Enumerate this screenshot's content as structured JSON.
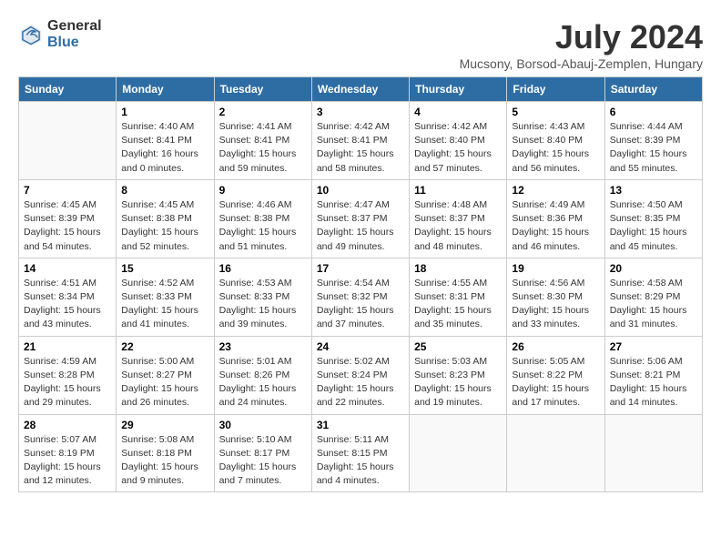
{
  "logo": {
    "text_general": "General",
    "text_blue": "Blue"
  },
  "title": "July 2024",
  "subtitle": "Mucsony, Borsod-Abauj-Zemplen, Hungary",
  "days_of_week": [
    "Sunday",
    "Monday",
    "Tuesday",
    "Wednesday",
    "Thursday",
    "Friday",
    "Saturday"
  ],
  "weeks": [
    [
      {
        "day": "",
        "info": ""
      },
      {
        "day": "1",
        "info": "Sunrise: 4:40 AM\nSunset: 8:41 PM\nDaylight: 16 hours\nand 0 minutes."
      },
      {
        "day": "2",
        "info": "Sunrise: 4:41 AM\nSunset: 8:41 PM\nDaylight: 15 hours\nand 59 minutes."
      },
      {
        "day": "3",
        "info": "Sunrise: 4:42 AM\nSunset: 8:41 PM\nDaylight: 15 hours\nand 58 minutes."
      },
      {
        "day": "4",
        "info": "Sunrise: 4:42 AM\nSunset: 8:40 PM\nDaylight: 15 hours\nand 57 minutes."
      },
      {
        "day": "5",
        "info": "Sunrise: 4:43 AM\nSunset: 8:40 PM\nDaylight: 15 hours\nand 56 minutes."
      },
      {
        "day": "6",
        "info": "Sunrise: 4:44 AM\nSunset: 8:39 PM\nDaylight: 15 hours\nand 55 minutes."
      }
    ],
    [
      {
        "day": "7",
        "info": "Sunrise: 4:45 AM\nSunset: 8:39 PM\nDaylight: 15 hours\nand 54 minutes."
      },
      {
        "day": "8",
        "info": "Sunrise: 4:45 AM\nSunset: 8:38 PM\nDaylight: 15 hours\nand 52 minutes."
      },
      {
        "day": "9",
        "info": "Sunrise: 4:46 AM\nSunset: 8:38 PM\nDaylight: 15 hours\nand 51 minutes."
      },
      {
        "day": "10",
        "info": "Sunrise: 4:47 AM\nSunset: 8:37 PM\nDaylight: 15 hours\nand 49 minutes."
      },
      {
        "day": "11",
        "info": "Sunrise: 4:48 AM\nSunset: 8:37 PM\nDaylight: 15 hours\nand 48 minutes."
      },
      {
        "day": "12",
        "info": "Sunrise: 4:49 AM\nSunset: 8:36 PM\nDaylight: 15 hours\nand 46 minutes."
      },
      {
        "day": "13",
        "info": "Sunrise: 4:50 AM\nSunset: 8:35 PM\nDaylight: 15 hours\nand 45 minutes."
      }
    ],
    [
      {
        "day": "14",
        "info": "Sunrise: 4:51 AM\nSunset: 8:34 PM\nDaylight: 15 hours\nand 43 minutes."
      },
      {
        "day": "15",
        "info": "Sunrise: 4:52 AM\nSunset: 8:33 PM\nDaylight: 15 hours\nand 41 minutes."
      },
      {
        "day": "16",
        "info": "Sunrise: 4:53 AM\nSunset: 8:33 PM\nDaylight: 15 hours\nand 39 minutes."
      },
      {
        "day": "17",
        "info": "Sunrise: 4:54 AM\nSunset: 8:32 PM\nDaylight: 15 hours\nand 37 minutes."
      },
      {
        "day": "18",
        "info": "Sunrise: 4:55 AM\nSunset: 8:31 PM\nDaylight: 15 hours\nand 35 minutes."
      },
      {
        "day": "19",
        "info": "Sunrise: 4:56 AM\nSunset: 8:30 PM\nDaylight: 15 hours\nand 33 minutes."
      },
      {
        "day": "20",
        "info": "Sunrise: 4:58 AM\nSunset: 8:29 PM\nDaylight: 15 hours\nand 31 minutes."
      }
    ],
    [
      {
        "day": "21",
        "info": "Sunrise: 4:59 AM\nSunset: 8:28 PM\nDaylight: 15 hours\nand 29 minutes."
      },
      {
        "day": "22",
        "info": "Sunrise: 5:00 AM\nSunset: 8:27 PM\nDaylight: 15 hours\nand 26 minutes."
      },
      {
        "day": "23",
        "info": "Sunrise: 5:01 AM\nSunset: 8:26 PM\nDaylight: 15 hours\nand 24 minutes."
      },
      {
        "day": "24",
        "info": "Sunrise: 5:02 AM\nSunset: 8:24 PM\nDaylight: 15 hours\nand 22 minutes."
      },
      {
        "day": "25",
        "info": "Sunrise: 5:03 AM\nSunset: 8:23 PM\nDaylight: 15 hours\nand 19 minutes."
      },
      {
        "day": "26",
        "info": "Sunrise: 5:05 AM\nSunset: 8:22 PM\nDaylight: 15 hours\nand 17 minutes."
      },
      {
        "day": "27",
        "info": "Sunrise: 5:06 AM\nSunset: 8:21 PM\nDaylight: 15 hours\nand 14 minutes."
      }
    ],
    [
      {
        "day": "28",
        "info": "Sunrise: 5:07 AM\nSunset: 8:19 PM\nDaylight: 15 hours\nand 12 minutes."
      },
      {
        "day": "29",
        "info": "Sunrise: 5:08 AM\nSunset: 8:18 PM\nDaylight: 15 hours\nand 9 minutes."
      },
      {
        "day": "30",
        "info": "Sunrise: 5:10 AM\nSunset: 8:17 PM\nDaylight: 15 hours\nand 7 minutes."
      },
      {
        "day": "31",
        "info": "Sunrise: 5:11 AM\nSunset: 8:15 PM\nDaylight: 15 hours\nand 4 minutes."
      },
      {
        "day": "",
        "info": ""
      },
      {
        "day": "",
        "info": ""
      },
      {
        "day": "",
        "info": ""
      }
    ]
  ]
}
